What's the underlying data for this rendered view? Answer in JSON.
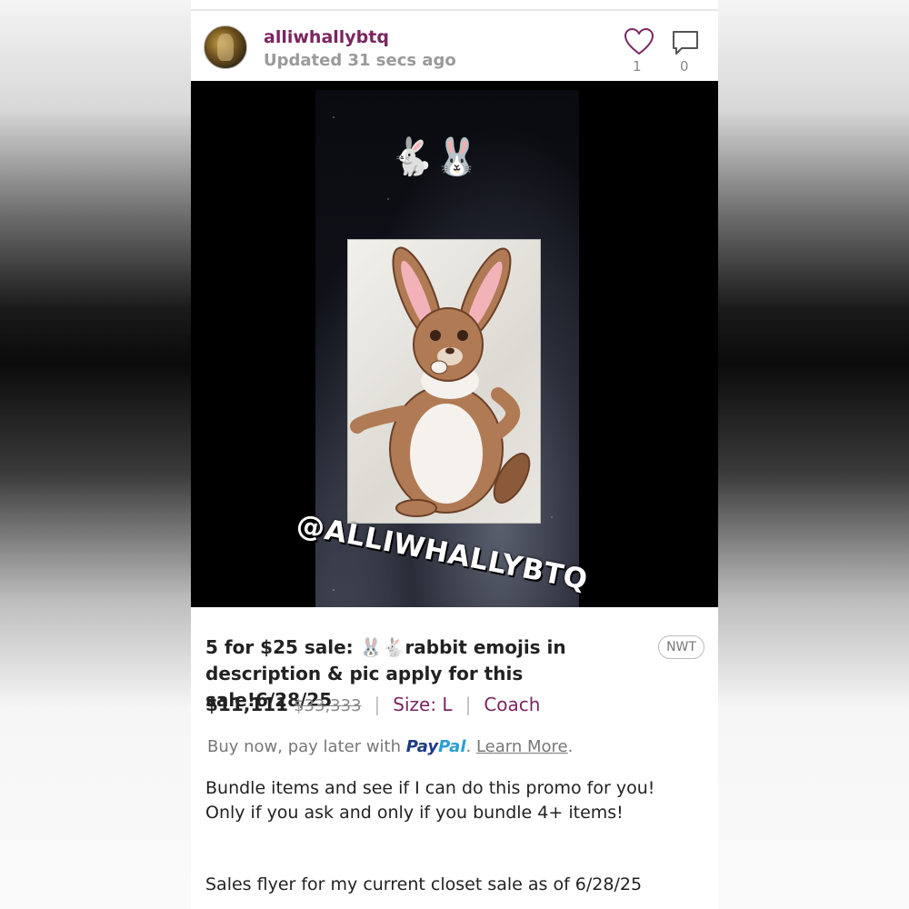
{
  "header": {
    "username": "alliwhallybtq",
    "updated": "Updated 31 secs ago",
    "like_count": "1",
    "comment_count": "0"
  },
  "image": {
    "emojis": "🐇🐰",
    "watermark": "@ALLIWHALLYBTQ"
  },
  "listing": {
    "title": "5 for $25 sale: 🐰🐇rabbit emojis in description & pic apply for this sale!6/28/25",
    "badge": "NWT",
    "price": "$11,111",
    "original_price": "$33,333",
    "size": "Size: L",
    "brand": "Coach",
    "paypal_prefix": "Buy now, pay later with",
    "paypal_pay": "Pay",
    "paypal_pal": "Pal",
    "learn_more": "Learn More",
    "learn_suffix": ".",
    "description_1": "Bundle items and see if I can do this promo for you! Only if you ask and only if you bundle 4+ items!",
    "description_2": "Sales flyer for my current closet sale as of 6/28/25"
  },
  "colors": {
    "accent": "#7b2560",
    "paypal_dark": "#1f3a87",
    "paypal_light": "#2a9fd6"
  }
}
